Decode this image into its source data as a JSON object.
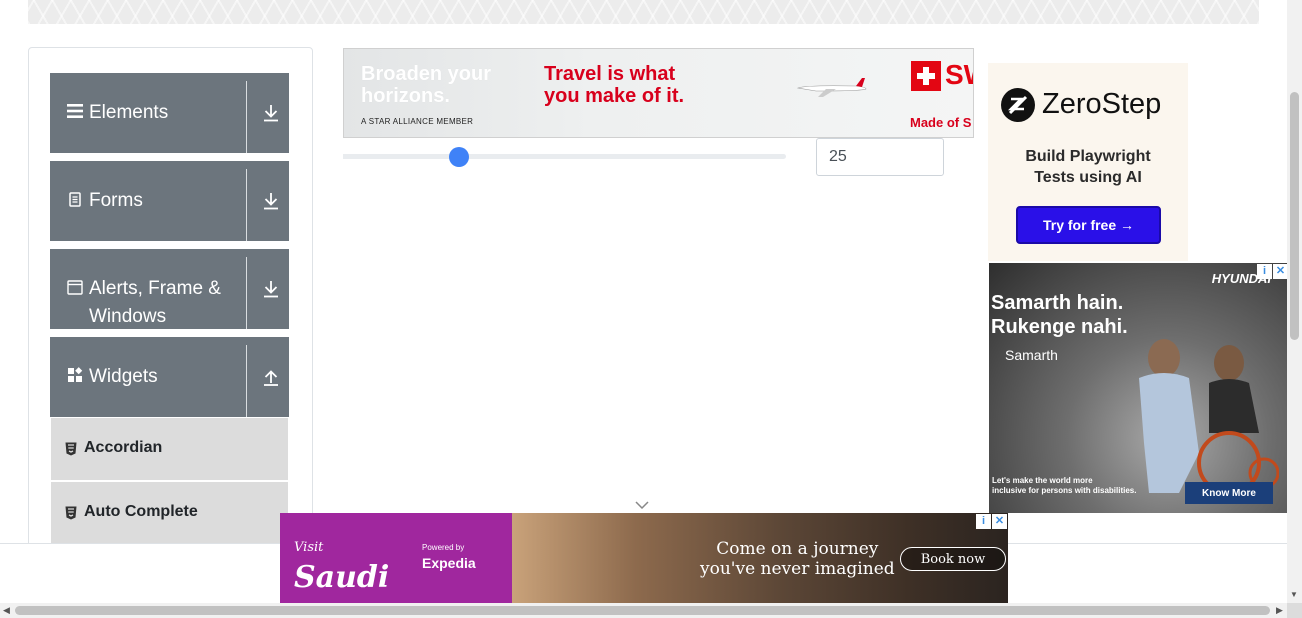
{
  "sidebar": {
    "groups": [
      {
        "label": "Elements",
        "icon": "hamburger-icon",
        "arrow": "download-arrow-icon"
      },
      {
        "label": "Forms",
        "icon": "document-icon",
        "arrow": "download-arrow-icon"
      },
      {
        "label": "Alerts, Frame & Windows",
        "icon": "window-icon",
        "arrow": "download-arrow-icon"
      },
      {
        "label": "Widgets",
        "icon": "widgets-icon",
        "arrow": "upload-arrow-icon"
      }
    ],
    "items": [
      {
        "label": "Accordian",
        "icon": "html5-icon"
      },
      {
        "label": "Auto Complete",
        "icon": "html5-icon"
      }
    ]
  },
  "slider": {
    "value": "25",
    "fraction": 0.25
  },
  "ads": {
    "top_banner": {
      "headline_left": [
        "Broaden your",
        "horizons."
      ],
      "alliance": "A STAR ALLIANCE MEMBER",
      "headline_right": [
        "Travel is what",
        "you make of it."
      ],
      "brand": "SW",
      "tagline": "Made of S"
    },
    "zerostep": {
      "name": "ZeroStep",
      "sub": [
        "Build Playwright",
        "Tests using AI"
      ],
      "button": "Try for free →"
    },
    "hyundai": {
      "brand": "HYUNDAI",
      "headline": [
        "Samarth hain.",
        "Rukenge nahi."
      ],
      "samarth": "Samarth",
      "footer": [
        "Let's make the world more",
        "inclusive for persons with disabilities."
      ],
      "button": "Know More"
    },
    "saudi": {
      "visit": [
        "Visit",
        "Saudi"
      ],
      "powered": "Powered by",
      "expedia": "Expedia",
      "tagline": [
        "Come on a journey",
        "you've never imagined"
      ],
      "button": "Book now"
    }
  },
  "colors": {
    "sidebar_group": "#6c757d",
    "sidebar_item": "#dcdcdc",
    "slider_thumb": "#3f82f7",
    "zerostep_button": "#2a10e8",
    "saudi_purple": "#a0279e"
  }
}
